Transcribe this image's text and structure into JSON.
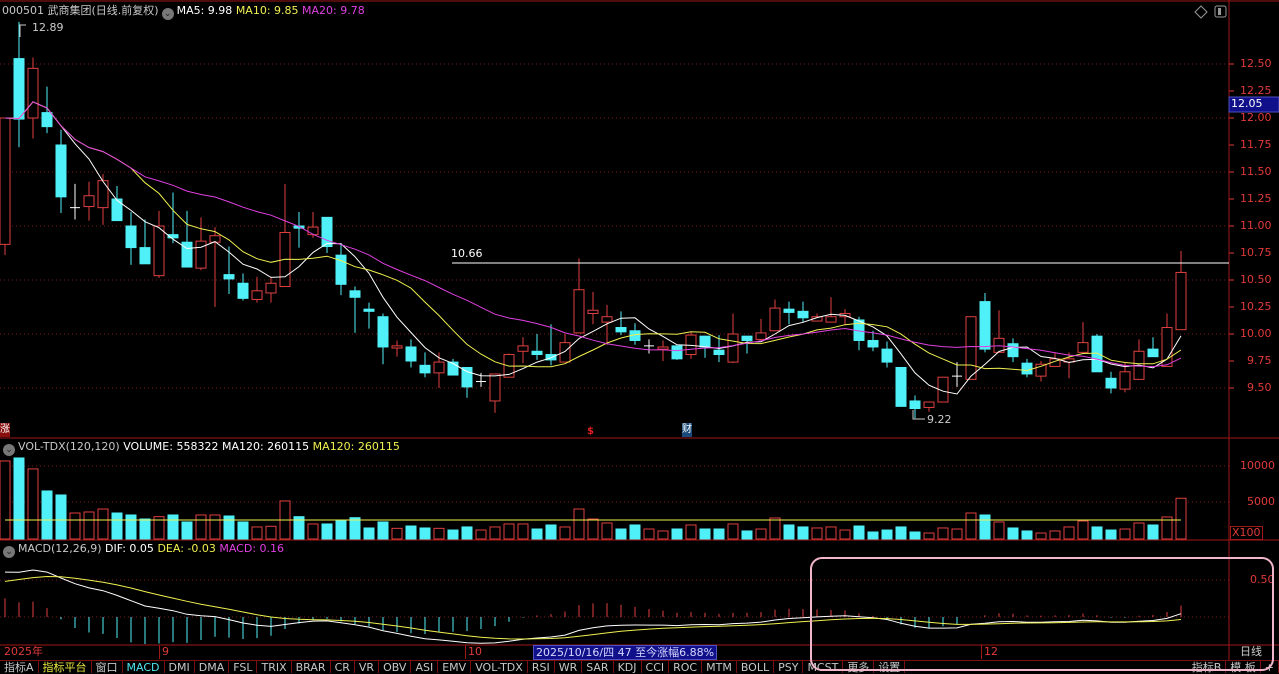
{
  "header": {
    "code": "000501",
    "name": "武商集团",
    "mode": "(日线.前复权)",
    "ma5": "MA5: 9.98",
    "ma10": "MA10: 9.85",
    "ma20": "MA20: 9.78"
  },
  "colors": {
    "up": "#e04040",
    "down": "#50f0f8",
    "ma5": "#ffffff",
    "ma10": "#f0f050",
    "ma20": "#e040e0",
    "axis": "#e03a3a",
    "grid": "#7a1a1a"
  },
  "price_axis": [
    "12.50",
    "12.25",
    "12.00",
    "11.75",
    "11.50",
    "11.25",
    "11.00",
    "10.75",
    "10.50",
    "10.25",
    "10.00",
    "9.75",
    "9.50"
  ],
  "current_price_tag": "12.05",
  "annotations": {
    "high": "12.89",
    "low": "9.22",
    "line_label": "10.66",
    "line_value": 10.66,
    "zhang": "涨",
    "dollar": "$",
    "cai": "财"
  },
  "candles": [
    [
      10.83,
      12.0,
      10.73,
      12.0
    ],
    [
      12.55,
      12.89,
      11.73,
      11.99
    ],
    [
      12.0,
      12.56,
      11.81,
      12.46
    ],
    [
      12.05,
      12.29,
      11.86,
      11.92
    ],
    [
      11.75,
      11.89,
      11.12,
      11.27
    ],
    [
      11.17,
      11.39,
      11.06,
      11.17
    ],
    [
      11.18,
      11.41,
      11.05,
      11.28
    ],
    [
      11.17,
      11.48,
      11.01,
      11.42
    ],
    [
      11.25,
      11.37,
      11.05,
      11.05
    ],
    [
      11.0,
      11.13,
      10.64,
      10.8
    ],
    [
      10.8,
      11.06,
      10.65,
      10.65
    ],
    [
      10.54,
      11.14,
      10.52,
      11.0
    ],
    [
      10.92,
      11.31,
      10.84,
      10.89
    ],
    [
      10.85,
      11.14,
      10.62,
      10.62
    ],
    [
      10.61,
      11.08,
      10.59,
      10.86
    ],
    [
      10.85,
      10.99,
      10.25,
      10.91
    ],
    [
      10.55,
      10.81,
      10.37,
      10.51
    ],
    [
      10.47,
      10.56,
      10.31,
      10.33
    ],
    [
      10.32,
      10.53,
      10.29,
      10.4
    ],
    [
      10.38,
      10.53,
      10.29,
      10.47
    ],
    [
      10.44,
      11.39,
      10.44,
      10.94
    ],
    [
      11.0,
      11.13,
      10.8,
      10.98
    ],
    [
      10.92,
      11.13,
      10.89,
      10.99
    ],
    [
      11.08,
      11.08,
      10.75,
      10.81
    ],
    [
      10.73,
      10.84,
      10.36,
      10.46
    ],
    [
      10.4,
      10.44,
      10.01,
      10.34
    ],
    [
      10.23,
      10.29,
      10.05,
      10.21
    ],
    [
      10.16,
      10.19,
      9.72,
      9.88
    ],
    [
      9.87,
      9.94,
      9.79,
      9.89
    ],
    [
      9.88,
      9.95,
      9.69,
      9.75
    ],
    [
      9.71,
      9.83,
      9.6,
      9.64
    ],
    [
      9.64,
      9.83,
      9.5,
      9.74
    ],
    [
      9.74,
      9.77,
      9.62,
      9.62
    ],
    [
      9.69,
      9.69,
      9.41,
      9.51
    ],
    [
      9.56,
      9.64,
      9.51,
      9.56
    ],
    [
      9.38,
      9.63,
      9.27,
      9.63
    ],
    [
      9.6,
      9.82,
      9.6,
      9.81
    ],
    [
      9.84,
      9.97,
      9.73,
      9.89
    ],
    [
      9.84,
      10.0,
      9.76,
      9.81
    ],
    [
      9.81,
      10.09,
      9.71,
      9.76
    ],
    [
      9.74,
      10.0,
      9.74,
      9.92
    ],
    [
      10.01,
      10.7,
      10.01,
      10.41
    ],
    [
      10.19,
      10.39,
      10.09,
      10.22
    ],
    [
      10.11,
      10.27,
      9.9,
      10.16
    ],
    [
      10.06,
      10.21,
      9.99,
      10.02
    ],
    [
      10.03,
      10.1,
      9.9,
      9.94
    ],
    [
      9.89,
      9.95,
      9.82,
      9.89
    ],
    [
      9.86,
      9.94,
      9.75,
      9.88
    ],
    [
      9.89,
      9.89,
      9.76,
      9.77
    ],
    [
      9.81,
      10.02,
      9.77,
      9.99
    ],
    [
      9.98,
      9.98,
      9.78,
      9.88
    ],
    [
      9.85,
      9.99,
      9.74,
      9.81
    ],
    [
      9.74,
      10.19,
      9.73,
      10.0
    ],
    [
      9.98,
      9.98,
      9.82,
      9.94
    ],
    [
      9.95,
      10.14,
      9.95,
      10.01
    ],
    [
      10.03,
      10.32,
      10.03,
      10.24
    ],
    [
      10.23,
      10.3,
      10.09,
      10.2
    ],
    [
      10.21,
      10.3,
      10.11,
      10.15
    ],
    [
      10.12,
      10.19,
      10.12,
      10.16
    ],
    [
      10.11,
      10.34,
      10.11,
      10.16
    ],
    [
      10.16,
      10.23,
      10.08,
      10.19
    ],
    [
      10.13,
      10.16,
      9.85,
      9.94
    ],
    [
      9.94,
      10.03,
      9.84,
      9.88
    ],
    [
      9.86,
      9.93,
      9.69,
      9.74
    ],
    [
      9.69,
      9.69,
      9.33,
      9.33
    ],
    [
      9.38,
      9.43,
      9.22,
      9.31
    ],
    [
      9.32,
      9.37,
      9.28,
      9.37
    ],
    [
      9.37,
      9.6,
      9.37,
      9.6
    ],
    [
      9.61,
      9.74,
      9.51,
      9.61
    ],
    [
      9.58,
      10.16,
      9.58,
      10.16
    ],
    [
      10.3,
      10.38,
      9.83,
      9.86
    ],
    [
      9.83,
      10.22,
      9.83,
      9.96
    ],
    [
      9.91,
      9.96,
      9.74,
      9.79
    ],
    [
      9.73,
      9.77,
      9.6,
      9.63
    ],
    [
      9.61,
      9.75,
      9.56,
      9.72
    ],
    [
      9.7,
      9.83,
      9.7,
      9.77
    ],
    [
      9.74,
      9.83,
      9.59,
      9.77
    ],
    [
      9.83,
      10.11,
      9.83,
      9.92
    ],
    [
      9.98,
      10.0,
      9.65,
      9.65
    ],
    [
      9.59,
      9.65,
      9.45,
      9.5
    ],
    [
      9.49,
      9.74,
      9.46,
      9.65
    ],
    [
      9.58,
      9.95,
      9.58,
      9.84
    ],
    [
      9.86,
      9.97,
      9.79,
      9.79
    ],
    [
      9.7,
      10.19,
      9.7,
      10.06
    ],
    [
      10.04,
      10.77,
      10.04,
      10.57
    ]
  ],
  "volume": {
    "title": "VOL-TDX(120,120)",
    "volume": "VOLUME: 558322",
    "ma120a": "MA120: 260115",
    "ma120b": "MA120: 260115",
    "ma120_value": 2601,
    "unit": "X100",
    "axis": [
      "10000",
      "5000"
    ],
    "values": [
      10690,
      11100,
      9600,
      6580,
      6030,
      3560,
      3700,
      4110,
      3560,
      3290,
      2740,
      3060,
      3290,
      2330,
      3290,
      3290,
      3150,
      2330,
      1650,
      1740,
      5210,
      3060,
      2060,
      2060,
      2600,
      2920,
      1510,
      2330,
      1460,
      1780,
      1510,
      1460,
      1230,
      1650,
      1230,
      1650,
      2060,
      2060,
      1370,
      1920,
      1650,
      4110,
      2740,
      2190,
      1370,
      1920,
      1370,
      1100,
      1370,
      1920,
      1370,
      1370,
      2060,
      1100,
      1370,
      2880,
      1920,
      1650,
      1510,
      1650,
      1230,
      1780,
      960,
      1230,
      1650,
      960,
      820,
      1510,
      1370,
      3560,
      3290,
      2330,
      1510,
      1100,
      820,
      1100,
      1650,
      2470,
      1650,
      1230,
      1370,
      2190,
      1920,
      3020,
      5580
    ]
  },
  "macd": {
    "title": "MACD(12,26,9)",
    "dif": "DIF: 0.05",
    "dea": "DEA: -0.03",
    "macd": "MACD: 0.16",
    "axis": "0.50"
  },
  "timeline": {
    "year": "2025年",
    "m9": "9",
    "m10": "10",
    "m12": "12",
    "date_box": "2025/10/16/四 47 至今涨幅6.88%",
    "period": "日线"
  },
  "tabs": [
    "指标A",
    "指标平台",
    "窗口",
    "MACD",
    "DMI",
    "DMA",
    "FSL",
    "TRIX",
    "BRAR",
    "CR",
    "VR",
    "OBV",
    "ASI",
    "EMV",
    "VOL-TDX",
    "RSI",
    "WR",
    "SAR",
    "KDJ",
    "CCI",
    "ROC",
    "MTM",
    "BOLL",
    "PSY",
    "MCST",
    "更多",
    "设置"
  ],
  "right_tabs": [
    "指标B",
    "模 板",
    "+"
  ]
}
